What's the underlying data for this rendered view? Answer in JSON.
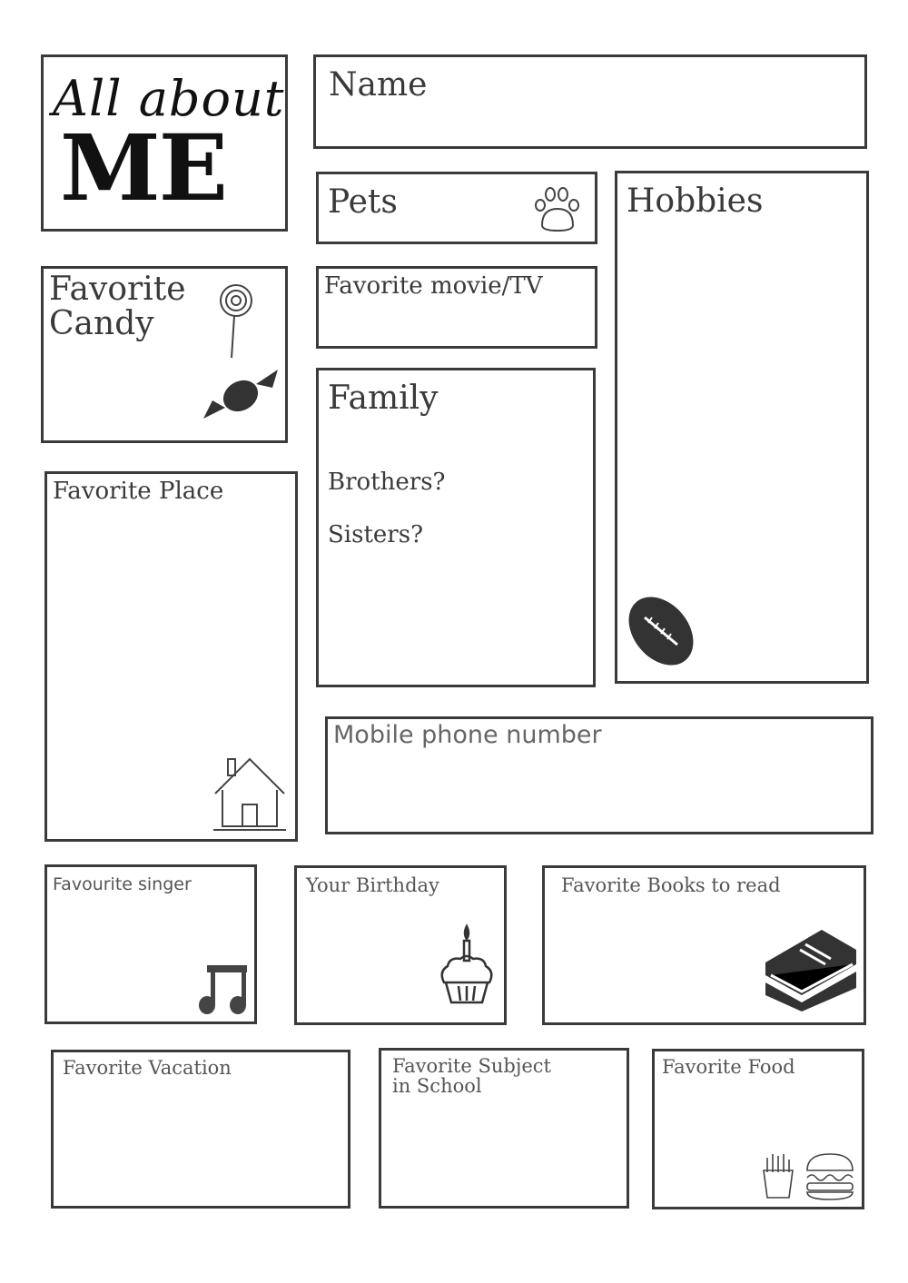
{
  "title": {
    "line1": "All about",
    "line2": "ME"
  },
  "fields": {
    "name": "Name",
    "pets": "Pets",
    "hobbies": "Hobbies",
    "candy": "Favorite\nCandy",
    "movie": "Favorite movie/TV",
    "family": "Family",
    "brothers": "Brothers?",
    "sisters": "Sisters?",
    "place": "Favorite Place",
    "phone": "Mobile phone number",
    "singer": "Favourite singer",
    "birthday": "Your Birthday",
    "books": "Favorite Books to read",
    "vacation": "Favorite Vacation",
    "subject": "Favorite Subject\nin School",
    "food": "Favorite Food"
  },
  "icons": [
    "paw-icon",
    "lollipop-icon",
    "candy-icon",
    "football-icon",
    "house-icon",
    "music-note-icon",
    "cupcake-icon",
    "books-icon",
    "fries-icon",
    "burger-icon"
  ]
}
